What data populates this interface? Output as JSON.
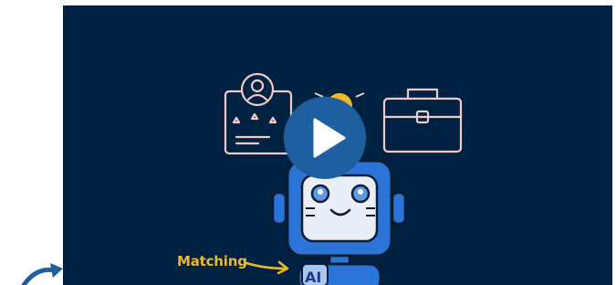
{
  "video": {
    "caption_label": "Matching",
    "robot_chest_text": "AI",
    "colors": {
      "background": "#002242",
      "line_art": "#f2c9c4",
      "caption": "#f2b824",
      "play_button": "#1e5fa0",
      "robot_blue": "#2a74d8"
    },
    "icons": [
      "profile-card-icon",
      "lightbulb-icon",
      "briefcase-icon",
      "robot-illustration",
      "play-icon"
    ]
  }
}
